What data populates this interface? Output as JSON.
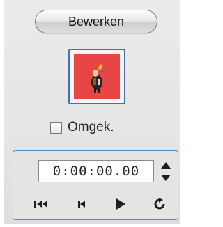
{
  "edit_button": {
    "label": "Bewerken"
  },
  "reverse": {
    "label": "Omgek.",
    "checked": false
  },
  "timecode": {
    "value": "0:00:00.00"
  },
  "icons": {
    "thumbnail": "clip-thumbnail-image",
    "spinner_up": "arrow-up-icon",
    "spinner_down": "arrow-down-icon",
    "go_to_start": "skip-to-start-icon",
    "previous_frame": "step-back-icon",
    "play": "play-icon",
    "loop": "loop-icon"
  },
  "colors": {
    "accent_border": "#3f6fc2",
    "thumbnail_bg": "#e84545"
  }
}
